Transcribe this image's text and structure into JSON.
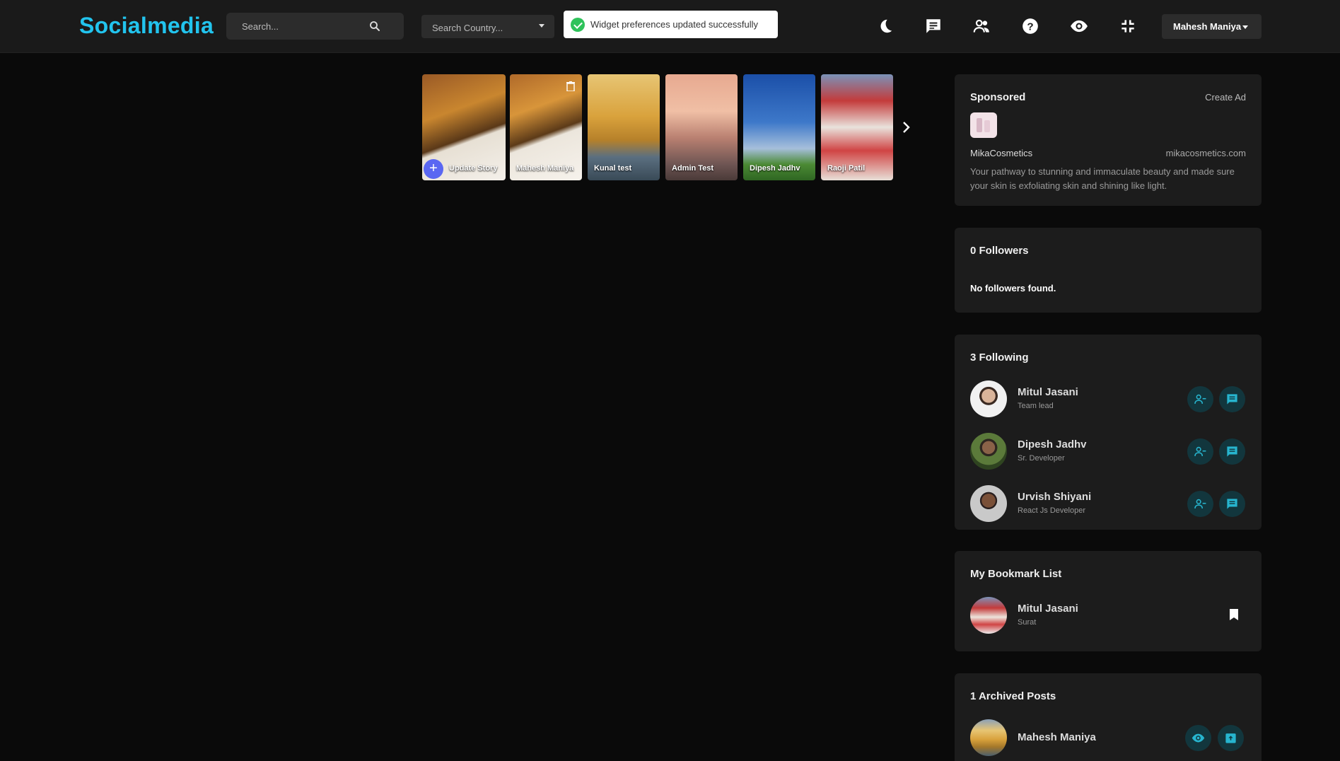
{
  "app": {
    "logo": "Socialmedia"
  },
  "header": {
    "search_placeholder": "Search...",
    "country_placeholder": "Search Country...",
    "toast_message": "Widget preferences updated successfully",
    "user_name": "Mahesh Maniya",
    "icons": [
      "moon-icon",
      "chat-icon",
      "people-icon",
      "help-icon",
      "eye-icon",
      "minimize-icon"
    ]
  },
  "stories": {
    "items": [
      {
        "label": "Update Story"
      },
      {
        "label": "Mahesh Maniya"
      },
      {
        "label": "Kunal test"
      },
      {
        "label": "Admin Test"
      },
      {
        "label": "Dipesh Jadhv"
      },
      {
        "label": "Raoji Patil"
      }
    ]
  },
  "sponsored": {
    "title": "Sponsored",
    "create_ad": "Create Ad",
    "brand": "MikaCosmetics",
    "url": "mikacosmetics.com",
    "description": "Your pathway to stunning and immaculate beauty and made sure your skin is exfoliating skin and shining like light."
  },
  "followers": {
    "title": "0 Followers",
    "empty": "No followers found."
  },
  "following": {
    "title": "3 Following",
    "people": [
      {
        "name": "Mitul Jasani",
        "role": "Team lead"
      },
      {
        "name": "Dipesh Jadhv",
        "role": "Sr. Developer"
      },
      {
        "name": "Urvish Shiyani",
        "role": "React Js Developer"
      }
    ]
  },
  "bookmarks": {
    "title": "My Bookmark List",
    "items": [
      {
        "name": "Mitul Jasani",
        "location": "Surat"
      }
    ]
  },
  "archived": {
    "title": "1 Archived Posts",
    "items": [
      {
        "name": "Mahesh Maniya"
      }
    ]
  },
  "colors": {
    "brand": "#22c4ee",
    "accent": "#5a67f2",
    "success": "#2ec25a",
    "button_bg": "#12363d",
    "button_icon": "#27b5cf"
  }
}
